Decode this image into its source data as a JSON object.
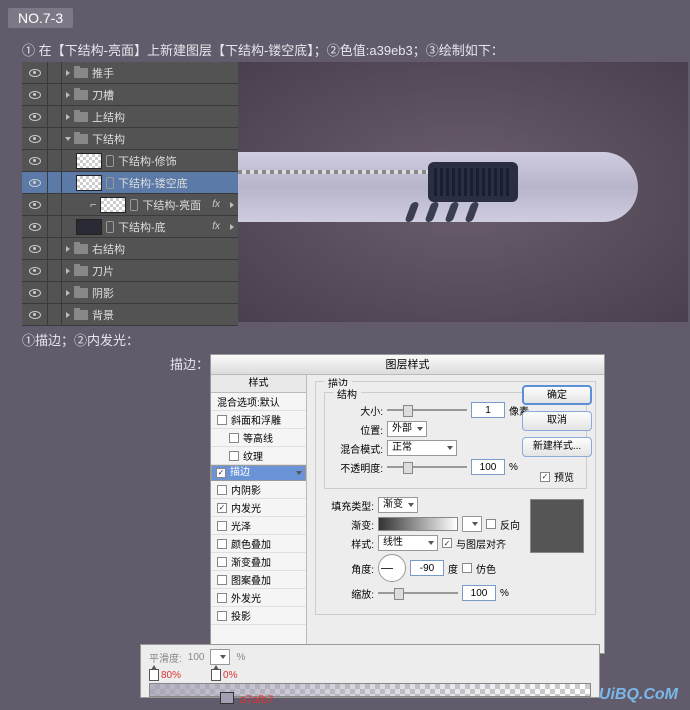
{
  "badge": "NO.7-3",
  "instruction1": "① 在【下结构-亮面】上新建图层【下结构-镂空底】；②色值:a39eb3；③绘制如下：",
  "instruction2": "①描边；②内发光：",
  "dialog_label": "描边：",
  "layers": [
    {
      "name": "推手",
      "type": "folder",
      "indent": 0,
      "vis": true
    },
    {
      "name": "刀槽",
      "type": "folder",
      "indent": 0,
      "vis": true
    },
    {
      "name": "上结构",
      "type": "folder",
      "indent": 0,
      "vis": true
    },
    {
      "name": "下结构",
      "type": "folder",
      "indent": 0,
      "vis": true,
      "open": true
    },
    {
      "name": "下结构-修饰",
      "type": "layer",
      "indent": 1,
      "vis": true,
      "thumb": "checker"
    },
    {
      "name": "下结构-镂空底",
      "type": "layer",
      "indent": 1,
      "vis": true,
      "sel": true,
      "thumb": "checker"
    },
    {
      "name": "下结构-亮面",
      "type": "layer",
      "indent": 2,
      "vis": true,
      "fx": true,
      "clip": true,
      "thumb": "checker"
    },
    {
      "name": "下结构-底",
      "type": "layer",
      "indent": 1,
      "vis": true,
      "fx": true,
      "thumb": "dark"
    },
    {
      "name": "右结构",
      "type": "folder",
      "indent": 0,
      "vis": true
    },
    {
      "name": "刀片",
      "type": "folder",
      "indent": 0,
      "vis": true
    },
    {
      "name": "阴影",
      "type": "folder",
      "indent": 0,
      "vis": true
    },
    {
      "name": "背景",
      "type": "folder",
      "indent": 0,
      "vis": true
    }
  ],
  "fx_label": "fx",
  "dialog": {
    "title": "图层样式",
    "styles_header": "样式",
    "blend_header": "混合选项:默认",
    "styles": [
      {
        "label": "斜面和浮雕",
        "checked": false
      },
      {
        "label": "等高线",
        "checked": false,
        "sub": true
      },
      {
        "label": "纹理",
        "checked": false,
        "sub": true
      },
      {
        "label": "描边",
        "checked": true,
        "sel": true
      },
      {
        "label": "内阴影",
        "checked": false
      },
      {
        "label": "内发光",
        "checked": true
      },
      {
        "label": "光泽",
        "checked": false
      },
      {
        "label": "颜色叠加",
        "checked": false
      },
      {
        "label": "渐变叠加",
        "checked": false
      },
      {
        "label": "图案叠加",
        "checked": false
      },
      {
        "label": "外发光",
        "checked": false
      },
      {
        "label": "投影",
        "checked": false
      }
    ],
    "group_stroke": "描边",
    "group_struct": "结构",
    "size_label": "大小:",
    "size_val": "1",
    "size_unit": "像素",
    "pos_label": "位置:",
    "pos_val": "外部",
    "blend_label": "混合模式:",
    "blend_val": "正常",
    "opacity_label": "不透明度:",
    "opacity_val": "100",
    "pct": "%",
    "fill_label": "填充类型:",
    "fill_val": "渐变",
    "grad_label": "渐变:",
    "reverse": "反向",
    "style_label": "样式:",
    "style_val": "线性",
    "align": "与图层对齐",
    "angle_label": "角度:",
    "angle_val": "-90",
    "angle_unit": "度",
    "dither": "仿色",
    "scale_label": "缩放:",
    "scale_val": "100",
    "ok": "确定",
    "cancel": "取消",
    "newstyle": "新建样式...",
    "preview": "预览"
  },
  "footer": {
    "smooth_label": "平滑度:",
    "smooth_val": "100",
    "stop1": "80%",
    "stop2": "0%",
    "color_val": "a7afb7"
  },
  "watermark": "UiBQ.CoM"
}
